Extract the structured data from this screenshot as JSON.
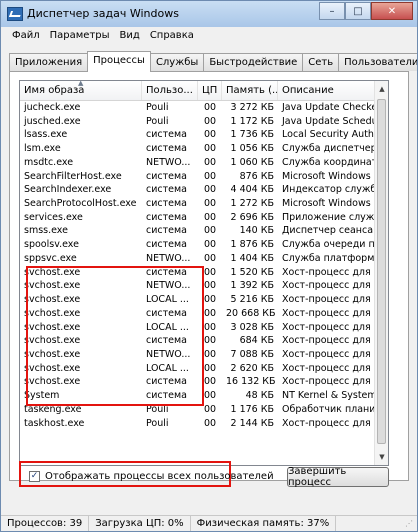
{
  "window": {
    "title": "Диспетчер задач Windows",
    "min": "–",
    "max": "□",
    "close": "✕"
  },
  "menu": [
    "Файл",
    "Параметры",
    "Вид",
    "Справка"
  ],
  "tabs": [
    "Приложения",
    "Процессы",
    "Службы",
    "Быстродействие",
    "Сеть",
    "Пользователи"
  ],
  "active_tab": 1,
  "table": {
    "columns": [
      "Имя образа",
      "Пользо...",
      "ЦП",
      "Память (...",
      "Описание"
    ],
    "rows": [
      [
        "jucheck.exe",
        "Pouli",
        "00",
        "3 272 КБ",
        "Java Update Checker"
      ],
      [
        "jusched.exe",
        "Pouli",
        "00",
        "1 172 КБ",
        "Java Update Schedule"
      ],
      [
        "lsass.exe",
        "система",
        "00",
        "1 736 КБ",
        "Local Security Authori"
      ],
      [
        "lsm.exe",
        "система",
        "00",
        "1 056 КБ",
        "Служба диспетчера л"
      ],
      [
        "msdtc.exe",
        "NETWO...",
        "00",
        "1 060 КБ",
        "Служба координатор"
      ],
      [
        "SearchFilterHost.exe",
        "система",
        "00",
        "876 КБ",
        "Microsoft Windows Sea"
      ],
      [
        "SearchIndexer.exe",
        "система",
        "00",
        "4 404 КБ",
        "Индексатор службы"
      ],
      [
        "SearchProtocolHost.exe",
        "система",
        "00",
        "1 272 КБ",
        "Microsoft Windows Sea"
      ],
      [
        "services.exe",
        "система",
        "00",
        "2 696 КБ",
        "Приложение служб и"
      ],
      [
        "smss.exe",
        "система",
        "00",
        "140 КБ",
        "Диспетчер сеанса W"
      ],
      [
        "spoolsv.exe",
        "система",
        "00",
        "1 876 КБ",
        "Служба очереди печ"
      ],
      [
        "sppsvc.exe",
        "NETWO...",
        "00",
        "1 404 КБ",
        "Служба платформы з"
      ],
      [
        "svchost.exe",
        "система",
        "00",
        "1 520 КБ",
        "Хост-процесс для слу"
      ],
      [
        "svchost.exe",
        "NETWO...",
        "00",
        "1 392 КБ",
        "Хост-процесс для слу"
      ],
      [
        "svchost.exe",
        "LOCAL ...",
        "00",
        "5 216 КБ",
        "Хост-процесс для слу"
      ],
      [
        "svchost.exe",
        "система",
        "00",
        "20 668 КБ",
        "Хост-процесс для слу"
      ],
      [
        "svchost.exe",
        "LOCAL ...",
        "00",
        "3 028 КБ",
        "Хост-процесс для слу"
      ],
      [
        "svchost.exe",
        "система",
        "00",
        "684 КБ",
        "Хост-процесс для слу"
      ],
      [
        "svchost.exe",
        "NETWO...",
        "00",
        "7 088 КБ",
        "Хост-процесс для слу"
      ],
      [
        "svchost.exe",
        "LOCAL ...",
        "00",
        "2 620 КБ",
        "Хост-процесс для слу"
      ],
      [
        "svchost.exe",
        "система",
        "00",
        "16 132 КБ",
        "Хост-процесс для слу"
      ],
      [
        "System",
        "система",
        "00",
        "48 КБ",
        "NT Kernel & System"
      ],
      [
        "taskeng.exe",
        "Pouli",
        "00",
        "1 176 КБ",
        "Обработчик планиро"
      ],
      [
        "taskhost.exe",
        "Pouli",
        "00",
        "2 144 КБ",
        "Хост-процесс для за"
      ]
    ]
  },
  "show_all_users": {
    "checked": true,
    "mark": "✓",
    "label": "Отображать процессы всех пользователей"
  },
  "end_process_button": "Завершить процесс",
  "status": [
    "Процессов: 39",
    "Загрузка ЦП: 0%",
    "Физическая память: 37%"
  ],
  "highlight_color": "#e3140f"
}
